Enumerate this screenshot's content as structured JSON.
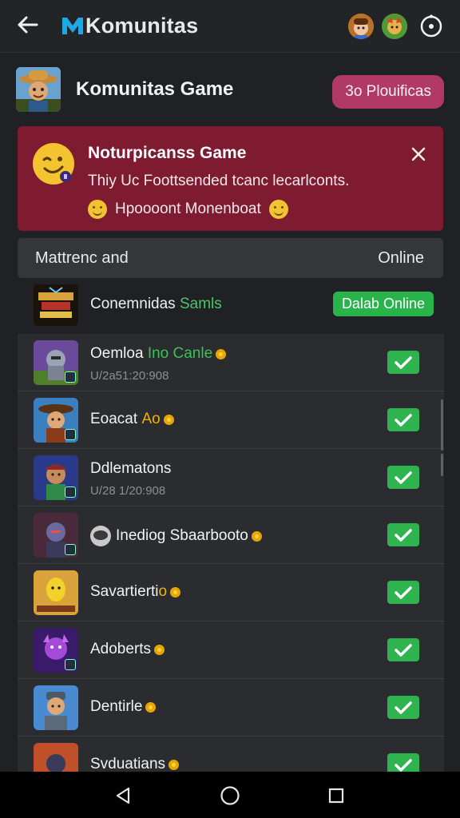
{
  "topbar": {
    "title": "Komunitas",
    "back_icon": "arrow-left-icon",
    "settings_icon": "settings-ring-icon"
  },
  "group": {
    "title": "Komunitas Game",
    "button_label": "3o Plouificas"
  },
  "notice": {
    "title": "Noturpicanss Game",
    "text": "Thiy Uc Foottsended tcanc lecarlconts.",
    "sub_text": "Hpoooont Monenboat",
    "close_icon": "close-icon",
    "color": "#7e1b31"
  },
  "list_header": {
    "left": "Mattrenc and",
    "right": "Online"
  },
  "featured": {
    "title_prefix": "Conemnidas",
    "title_highlight": "Samls",
    "button_label": "Dalab Online"
  },
  "members": [
    {
      "name": "Oemloa",
      "highlight": "Ino Canle",
      "highlight_color": "green",
      "sub": "U/2a51:20:908"
    },
    {
      "name": "Eoacat",
      "highlight": "Ao",
      "highlight_color": "yellow",
      "sub": ""
    },
    {
      "name": "Ddlematons",
      "highlight": "",
      "highlight_color": "",
      "sub": "U/28 1/20:908"
    },
    {
      "name": "Inediog Sbaarbooto",
      "highlight": "",
      "highlight_color": "",
      "sub": ""
    },
    {
      "name": "Savartierti",
      "highlight": "o",
      "highlight_color": "yellow",
      "sub": ""
    },
    {
      "name": "Adoberts",
      "highlight": "",
      "highlight_color": "",
      "sub": ""
    },
    {
      "name": "Dentirle",
      "highlight": "",
      "highlight_color": "",
      "sub": ""
    },
    {
      "name": "Svduatians",
      "highlight": "",
      "highlight_color": "",
      "sub": ""
    }
  ],
  "colors": {
    "accent_pink": "#b03a63",
    "online_green": "#29b34b",
    "background": "#202124"
  }
}
